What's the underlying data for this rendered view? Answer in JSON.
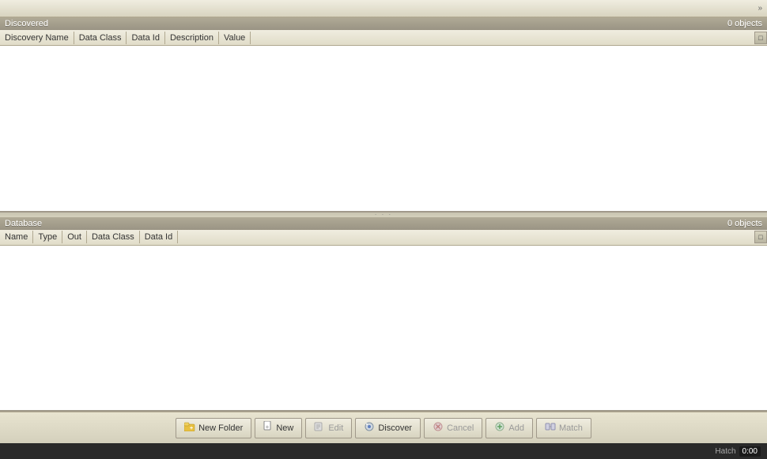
{
  "toolbar": {
    "arrow": "»"
  },
  "discovered_panel": {
    "title": "Discovered",
    "count": "0 objects",
    "columns": [
      {
        "label": "Discovery Name"
      },
      {
        "label": "Data Class"
      },
      {
        "label": "Data Id"
      },
      {
        "label": "Description"
      },
      {
        "label": "Value"
      }
    ]
  },
  "database_panel": {
    "title": "Database",
    "count": "0 objects",
    "columns": [
      {
        "label": "Name"
      },
      {
        "label": "Type"
      },
      {
        "label": "Out"
      },
      {
        "label": "Data Class"
      },
      {
        "label": "Data Id"
      }
    ]
  },
  "buttons": {
    "new_folder": "New Folder",
    "new": "New",
    "edit": "Edit",
    "discover": "Discover",
    "cancel": "Cancel",
    "add": "Add",
    "match": "Match"
  },
  "status": {
    "time": "0:00",
    "hatch_label": "Hatch"
  }
}
